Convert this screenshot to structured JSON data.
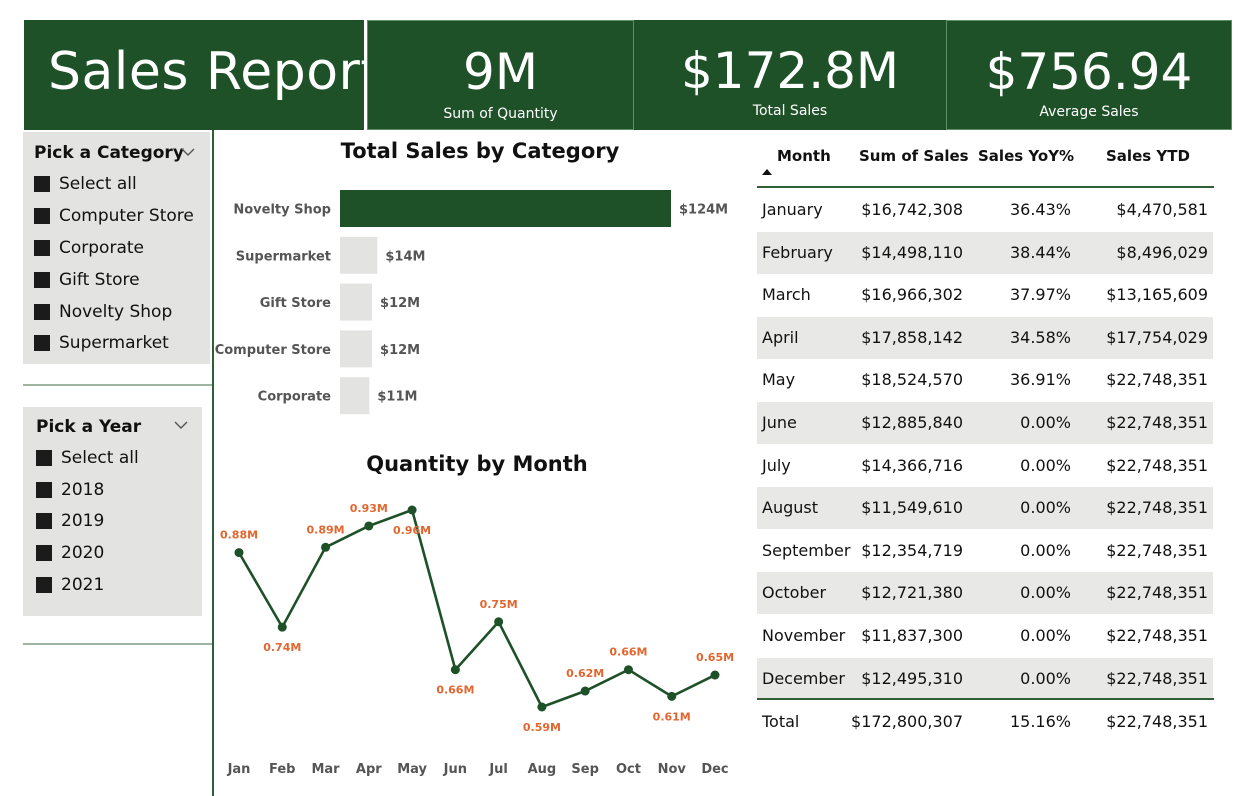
{
  "header": {
    "title": "Sales Report",
    "kpis": [
      {
        "value": "9M",
        "label": "Sum of Quantity"
      },
      {
        "value": "$172.8M",
        "label": "Total Sales"
      },
      {
        "value": "$756.94",
        "label": "Average Sales"
      }
    ]
  },
  "category_slicer": {
    "title": "Pick a Category",
    "items": [
      "Select all",
      "Computer Store",
      "Corporate",
      "Gift Store",
      "Novelty Shop",
      "Supermarket"
    ]
  },
  "year_slicer": {
    "title": "Pick a Year",
    "items": [
      "Select all",
      "2018",
      "2019",
      "2020",
      "2021"
    ]
  },
  "colors": {
    "brand": "#1e5128",
    "line_label": "#e2662f",
    "bar_inactive": "#e3e4e2",
    "slicer_bg": "#e3e4e2"
  },
  "chart_data": [
    {
      "type": "bar",
      "orientation": "horizontal",
      "title": "Total Sales by Category",
      "categories": [
        "Novelty Shop",
        "Supermarket",
        "Gift Store",
        "Computer Store",
        "Corporate"
      ],
      "values": [
        124,
        14,
        12,
        12,
        11
      ],
      "labels": [
        "$124M",
        "$14M",
        "$12M",
        "$12M",
        "$11M"
      ],
      "highlighted": "Novelty Shop"
    },
    {
      "type": "line",
      "title": "Quantity by Month",
      "x": [
        "Jan",
        "Feb",
        "Mar",
        "Apr",
        "May",
        "Jun",
        "Jul",
        "Aug",
        "Sep",
        "Oct",
        "Nov",
        "Dec"
      ],
      "values": [
        0.88,
        0.74,
        0.89,
        0.93,
        0.96,
        0.66,
        0.75,
        0.59,
        0.62,
        0.66,
        0.61,
        0.65
      ],
      "labels": [
        "0.88M",
        "0.74M",
        "0.89M",
        "0.93M",
        "0.96M",
        "0.66M",
        "0.75M",
        "0.59M",
        "0.62M",
        "0.66M",
        "0.61M",
        "0.65M"
      ],
      "label_position": [
        "above",
        "below",
        "above",
        "above",
        "below",
        "below",
        "above",
        "below",
        "above",
        "above",
        "below",
        "above"
      ]
    },
    {
      "type": "table",
      "columns": [
        "Month",
        "Sum of Sales",
        "Sales YoY%",
        "Sales YTD"
      ],
      "rows": [
        [
          "January",
          "$16,742,308",
          "36.43%",
          "$4,470,581"
        ],
        [
          "February",
          "$14,498,110",
          "38.44%",
          "$8,496,029"
        ],
        [
          "March",
          "$16,966,302",
          "37.97%",
          "$13,165,609"
        ],
        [
          "April",
          "$17,858,142",
          "34.58%",
          "$17,754,029"
        ],
        [
          "May",
          "$18,524,570",
          "36.91%",
          "$22,748,351"
        ],
        [
          "June",
          "$12,885,840",
          "0.00%",
          "$22,748,351"
        ],
        [
          "July",
          "$14,366,716",
          "0.00%",
          "$22,748,351"
        ],
        [
          "August",
          "$11,549,610",
          "0.00%",
          "$22,748,351"
        ],
        [
          "September",
          "$12,354,719",
          "0.00%",
          "$22,748,351"
        ],
        [
          "October",
          "$12,721,380",
          "0.00%",
          "$22,748,351"
        ],
        [
          "November",
          "$11,837,300",
          "0.00%",
          "$22,748,351"
        ],
        [
          "December",
          "$12,495,310",
          "0.00%",
          "$22,748,351"
        ]
      ],
      "total": [
        "Total",
        "$172,800,307",
        "15.16%",
        "$22,748,351"
      ],
      "sort_column": "Month",
      "sort_direction": "ascending"
    }
  ]
}
